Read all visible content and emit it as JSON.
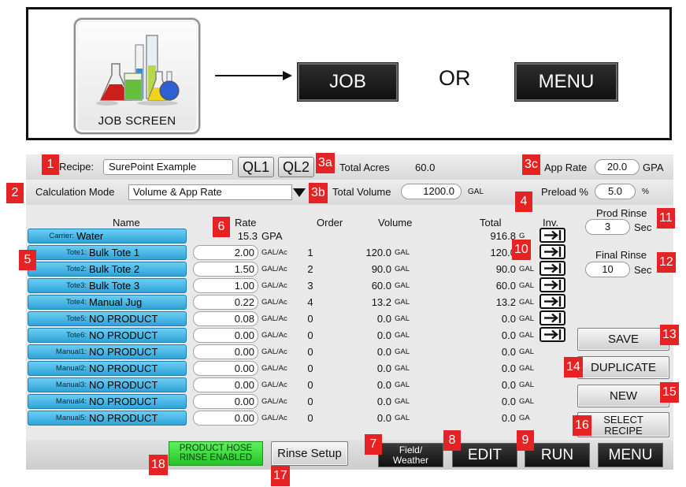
{
  "guide": {
    "icon_label": "JOB SCREEN",
    "job_button": "JOB",
    "or_text": "OR",
    "menu_button": "MENU"
  },
  "header": {
    "recipe_label": "Recipe:",
    "recipe_value": "SurePoint Example",
    "ql1": "QL1",
    "ql2": "QL2",
    "total_acres_label": "Total Acres",
    "total_acres_value": "60.0",
    "app_rate_label": "App Rate",
    "app_rate_value": "20.0",
    "app_rate_unit": "GPA",
    "calc_mode_label": "Calculation Mode",
    "calc_mode_value": "Volume & App Rate",
    "total_volume_label": "Total Volume",
    "total_volume_value": "1200.0",
    "total_volume_unit": "GAL",
    "preload_label": "Preload %",
    "preload_value": "5.0",
    "preload_unit": "%"
  },
  "columns": {
    "name": "Name",
    "rate": "Rate",
    "order": "Order",
    "volume": "Volume",
    "total": "Total",
    "inv": "Inv."
  },
  "carrier": {
    "tag": "Carrier:",
    "name": "Water",
    "rate": "15.3",
    "rate_unit": "GPA",
    "total": "916.8",
    "total_unit": "G"
  },
  "rows": [
    {
      "tag": "Tote1:",
      "name": "Bulk Tote 1",
      "rate": "2.00",
      "rate_unit": "GAL/Ac",
      "order": "1",
      "volume": "120.0",
      "volume_unit": "GAL",
      "total": "120.0",
      "total_unit": "G"
    },
    {
      "tag": "Tote2:",
      "name": "Bulk Tote 2",
      "rate": "1.50",
      "rate_unit": "GAL/Ac",
      "order": "2",
      "volume": "90.0",
      "volume_unit": "GAL",
      "total": "90.0",
      "total_unit": "GAL"
    },
    {
      "tag": "Tote3:",
      "name": "Bulk Tote 3",
      "rate": "1.00",
      "rate_unit": "GAL/Ac",
      "order": "3",
      "volume": "60.0",
      "volume_unit": "GAL",
      "total": "60.0",
      "total_unit": "GAL"
    },
    {
      "tag": "Tote4:",
      "name": "Manual Jug",
      "rate": "0.22",
      "rate_unit": "GAL/Ac",
      "order": "4",
      "volume": "13.2",
      "volume_unit": "GAL",
      "total": "13.2",
      "total_unit": "GAL"
    },
    {
      "tag": "Tote5:",
      "name": "NO PRODUCT",
      "rate": "0.08",
      "rate_unit": "GAL/Ac",
      "order": "0",
      "volume": "0.0",
      "volume_unit": "GAL",
      "total": "0.0",
      "total_unit": "GAL"
    },
    {
      "tag": "Tote6:",
      "name": "NO PRODUCT",
      "rate": "0.00",
      "rate_unit": "GAL/Ac",
      "order": "0",
      "volume": "0.0",
      "volume_unit": "GAL",
      "total": "0.0",
      "total_unit": "GAL"
    },
    {
      "tag": "Manual1:",
      "name": "NO PRODUCT",
      "rate": "0.00",
      "rate_unit": "GAL/Ac",
      "order": "0",
      "volume": "0.0",
      "volume_unit": "GAL",
      "total": "0.0",
      "total_unit": "GAL"
    },
    {
      "tag": "Manual2:",
      "name": "NO PRODUCT",
      "rate": "0.00",
      "rate_unit": "GAL/Ac",
      "order": "0",
      "volume": "0.0",
      "volume_unit": "GAL",
      "total": "0.0",
      "total_unit": "GAL"
    },
    {
      "tag": "Manual3:",
      "name": "NO PRODUCT",
      "rate": "0.00",
      "rate_unit": "GAL/Ac",
      "order": "0",
      "volume": "0.0",
      "volume_unit": "GAL",
      "total": "0.0",
      "total_unit": "GAL"
    },
    {
      "tag": "Manual4:",
      "name": "NO PRODUCT",
      "rate": "0.00",
      "rate_unit": "GAL/Ac",
      "order": "0",
      "volume": "0.0",
      "volume_unit": "GAL",
      "total": "0.0",
      "total_unit": "GAL"
    },
    {
      "tag": "Manual5:",
      "name": "NO PRODUCT",
      "rate": "0.00",
      "rate_unit": "GAL/Ac",
      "order": "0",
      "volume": "0.0",
      "volume_unit": "GAL",
      "total": "0.0",
      "total_unit": "GA"
    }
  ],
  "side": {
    "prod_rinse_label": "Prod Rinse",
    "prod_rinse_value": "3",
    "prod_rinse_unit": "Sec",
    "final_rinse_label": "Final Rinse",
    "final_rinse_value": "10",
    "final_rinse_unit": "Sec",
    "save": "SAVE",
    "duplicate": "DUPLICATE",
    "new": "NEW",
    "select_recipe_1": "SELECT",
    "select_recipe_2": "RECIPE"
  },
  "bottom": {
    "hose_rinse_1": "PRODUCT HOSE",
    "hose_rinse_2": "RINSE ENABLED",
    "rinse_setup": "Rinse Setup",
    "field_weather_1": "Field/",
    "field_weather_2": "Weather",
    "edit": "EDIT",
    "run": "RUN",
    "menu": "MENU"
  },
  "markers": [
    "1",
    "2",
    "3a",
    "3b",
    "3c",
    "4",
    "5",
    "6",
    "7",
    "8",
    "9",
    "10",
    "11",
    "12",
    "13",
    "14",
    "15",
    "16",
    "17",
    "18"
  ],
  "colors": {
    "marker_red": "#e52224",
    "product_button_blue": "#3fb3e4",
    "rinse_enabled_green": "#3fd93f"
  }
}
